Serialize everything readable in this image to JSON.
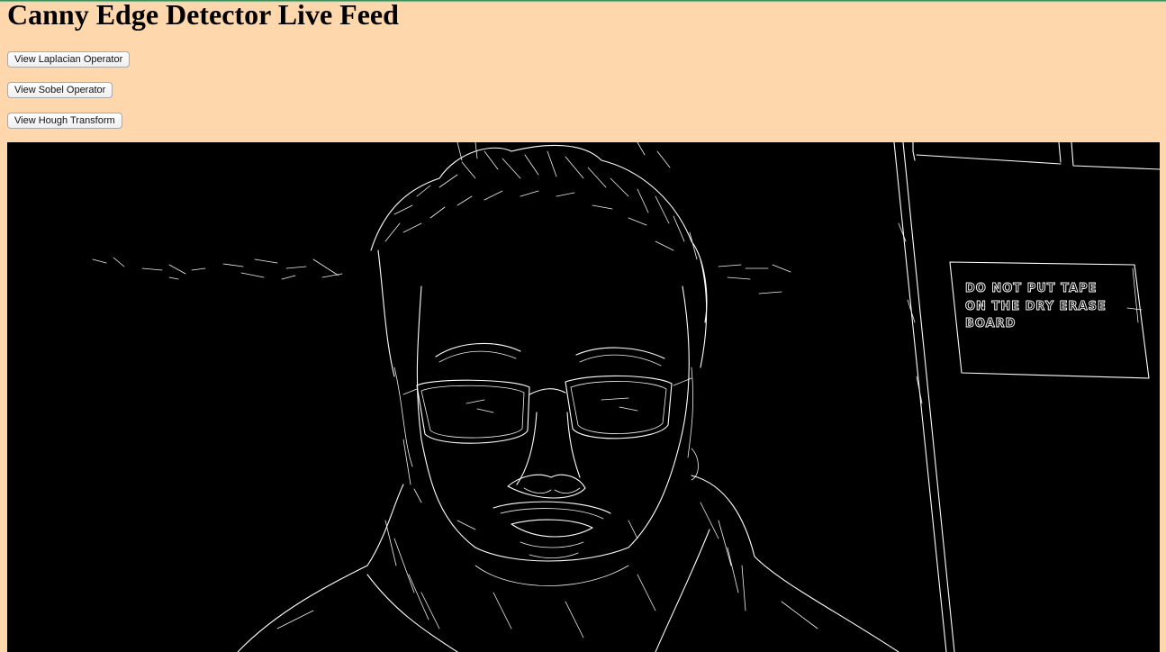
{
  "page": {
    "title": "Canny Edge Detector Live Feed"
  },
  "buttons": {
    "laplacian": "View Laplacian Operator",
    "sobel": "View Sobel Operator",
    "hough": "View Hough Transform"
  },
  "video_feed": {
    "sign_lines": [
      "DO NOT PUT TAPE",
      "ON THE DRY ERASE",
      "BOARD"
    ]
  },
  "colors": {
    "page_background": "#ffd7ad",
    "feed_background": "#000000",
    "edge_color": "#ffffff"
  }
}
